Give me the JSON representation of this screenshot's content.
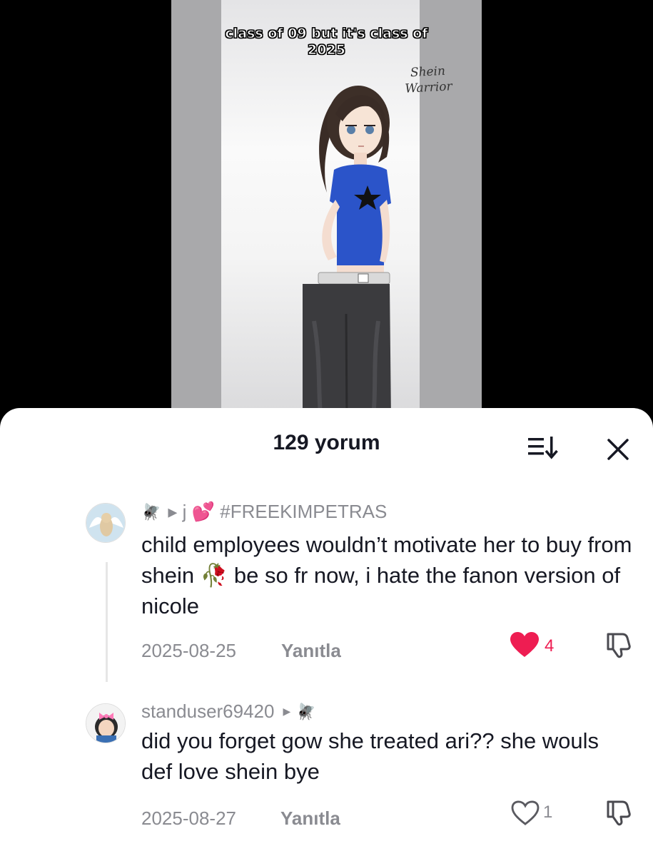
{
  "video": {
    "caption_line1": "class of 09 but it's class of",
    "caption_line2": "2025",
    "signature_line1": "Shein",
    "signature_line2": "Warrior"
  },
  "comments_panel": {
    "title": "129 yorum",
    "sort_icon": "sort-icon",
    "close_icon": "close-icon"
  },
  "comments": [
    {
      "username_prefix": "▸ j 💕 #FREEKIMPETRAS",
      "username_icon": "fly-emoji",
      "text": "child employees wouldn’t motivate her to buy from shein 🥀 be so fr now, i hate the fanon version of nicole",
      "date": "2025-08-25",
      "reply_label": "Yanıtla",
      "likes": "4",
      "liked": true,
      "like_color": "#ee1d52"
    },
    {
      "username": "standuser69420",
      "username_suffix_icon": "fly-emoji",
      "text": "did you forget gow she treated ari?? she wouls def love shein bye",
      "date": "2025-08-27",
      "reply_label": "Yanıtla",
      "likes": "1",
      "liked": false
    }
  ]
}
